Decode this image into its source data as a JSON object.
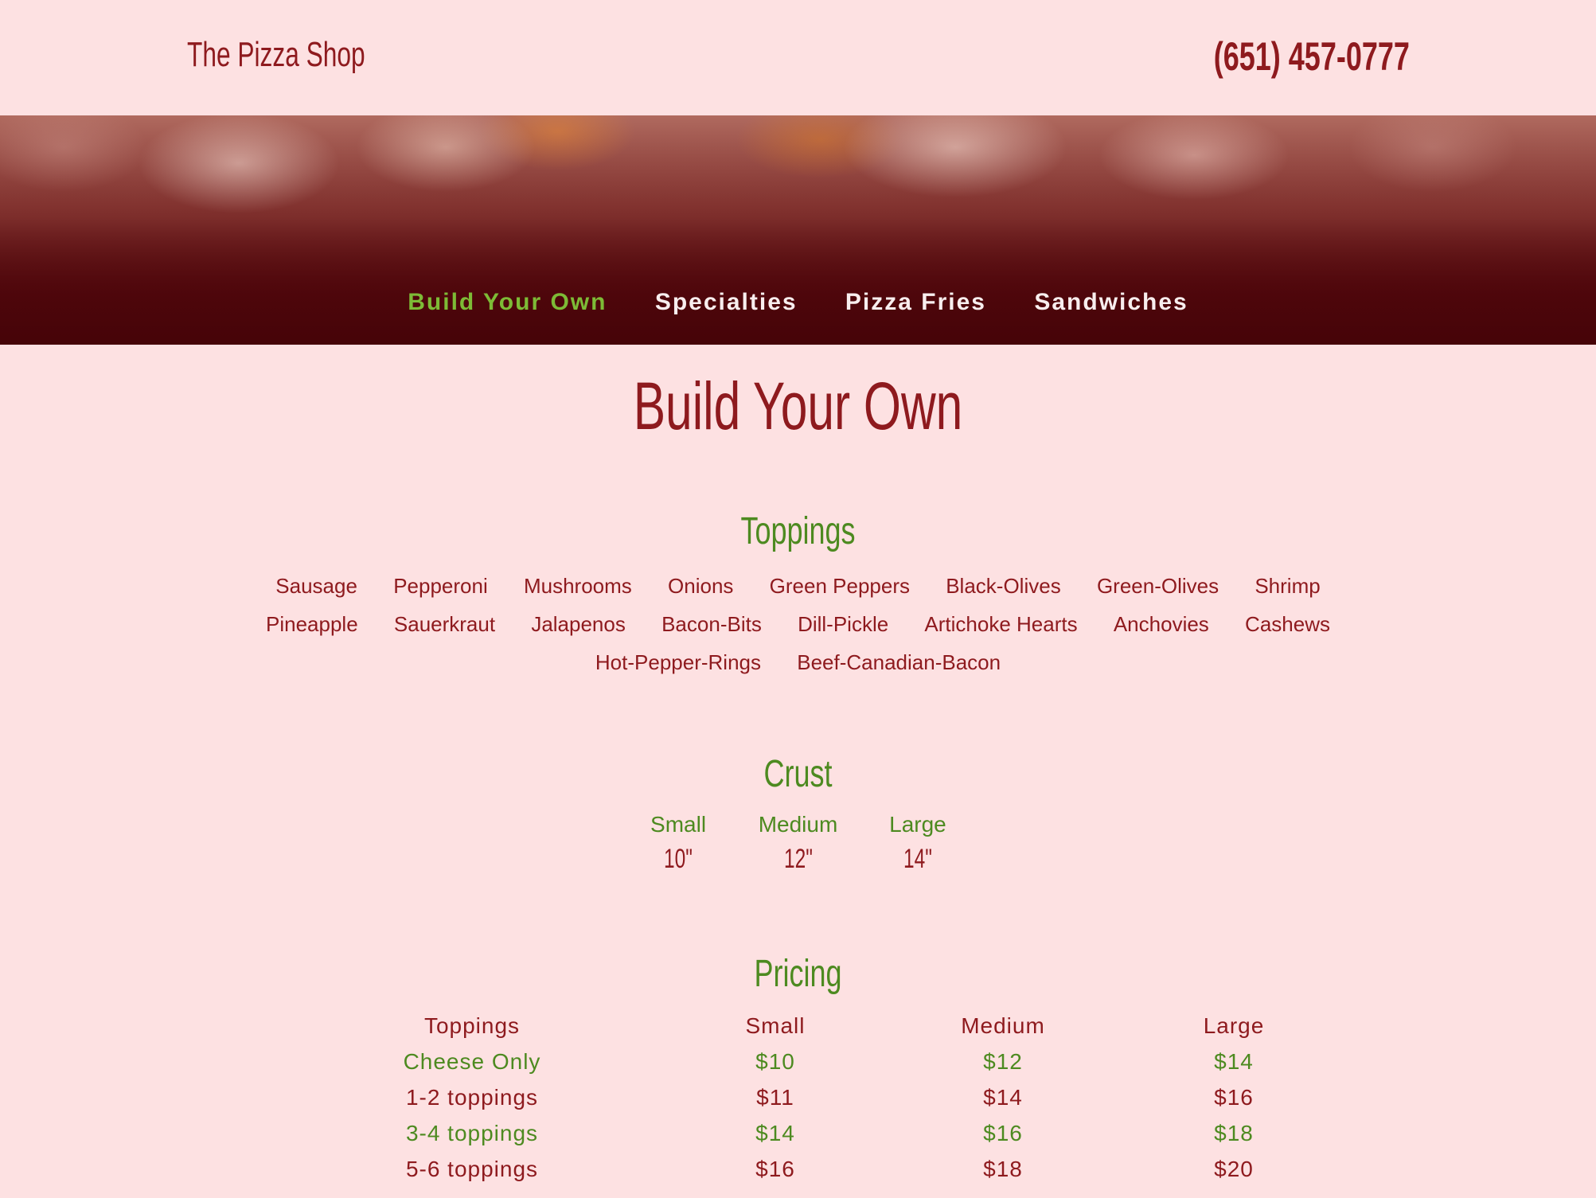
{
  "header": {
    "brand": "The Pizza Shop",
    "phone": "(651) 457-0777"
  },
  "nav": {
    "items": [
      {
        "label": "Build Your Own",
        "active": true
      },
      {
        "label": "Specialties",
        "active": false
      },
      {
        "label": "Pizza Fries",
        "active": false
      },
      {
        "label": "Sandwiches",
        "active": false
      }
    ]
  },
  "main": {
    "title": "Build Your Own",
    "toppings": {
      "heading": "Toppings",
      "items": [
        "Sausage",
        "Pepperoni",
        "Mushrooms",
        "Onions",
        "Green Peppers",
        "Black-Olives",
        "Green-Olives",
        "Shrimp",
        "Pineapple",
        "Sauerkraut",
        "Jalapenos",
        "Bacon-Bits",
        "Dill-Pickle",
        "Artichoke Hearts",
        "Anchovies",
        "Cashews",
        "Hot-Pepper-Rings",
        "Beef-Canadian-Bacon"
      ]
    },
    "crust": {
      "heading": "Crust",
      "sizes": [
        {
          "name": "Small",
          "inches": "10\""
        },
        {
          "name": "Medium",
          "inches": "12\""
        },
        {
          "name": "Large",
          "inches": "14\""
        }
      ]
    },
    "pricing": {
      "heading": "Pricing",
      "columns": [
        "Toppings",
        "Small",
        "Medium",
        "Large"
      ],
      "rows": [
        [
          "Cheese Only",
          "$10",
          "$12",
          "$14"
        ],
        [
          "1-2 toppings",
          "$11",
          "$14",
          "$16"
        ],
        [
          "3-4 toppings",
          "$14",
          "$16",
          "$18"
        ],
        [
          "5-6 toppings",
          "$16",
          "$18",
          "$20"
        ]
      ]
    }
  },
  "colors": {
    "background": "#fde1e2",
    "brand_red": "#8e1a1e",
    "accent_green": "#4d8a20",
    "nav_active": "#7dbb36",
    "nav_text": "#f8eeee"
  }
}
